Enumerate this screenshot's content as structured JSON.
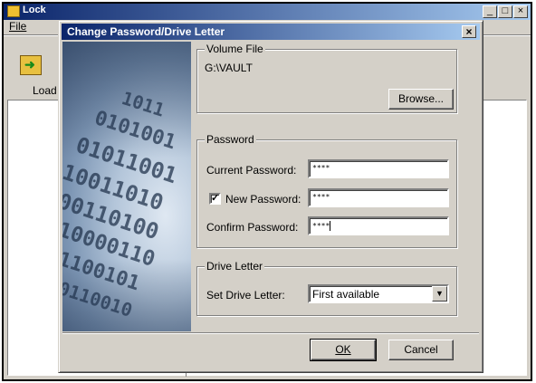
{
  "background_window": {
    "title": "Lock",
    "menu": {
      "file_label": "File"
    },
    "toolbar": {
      "load_label": "Load",
      "load_icon": "load-folder-icon"
    }
  },
  "dialog": {
    "title": "Change Password/Drive Letter",
    "volume_group": {
      "label": "Volume File",
      "path": "G:\\VAULT",
      "browse_label": "Browse..."
    },
    "password_group": {
      "label": "Password",
      "current_label": "Current Password:",
      "current_value": "****",
      "new_checkbox_checked": true,
      "new_label": "New Password:",
      "new_value": "****",
      "confirm_label": "Confirm Password:",
      "confirm_value": "****"
    },
    "drive_group": {
      "label": "Drive Letter",
      "set_label": "Set Drive Letter:",
      "selected": "First available"
    },
    "buttons": {
      "ok": "OK",
      "cancel": "Cancel"
    }
  },
  "colors": {
    "titlebar_start": "#0a246a",
    "titlebar_end": "#a6caf0",
    "face": "#d4d0c8"
  }
}
